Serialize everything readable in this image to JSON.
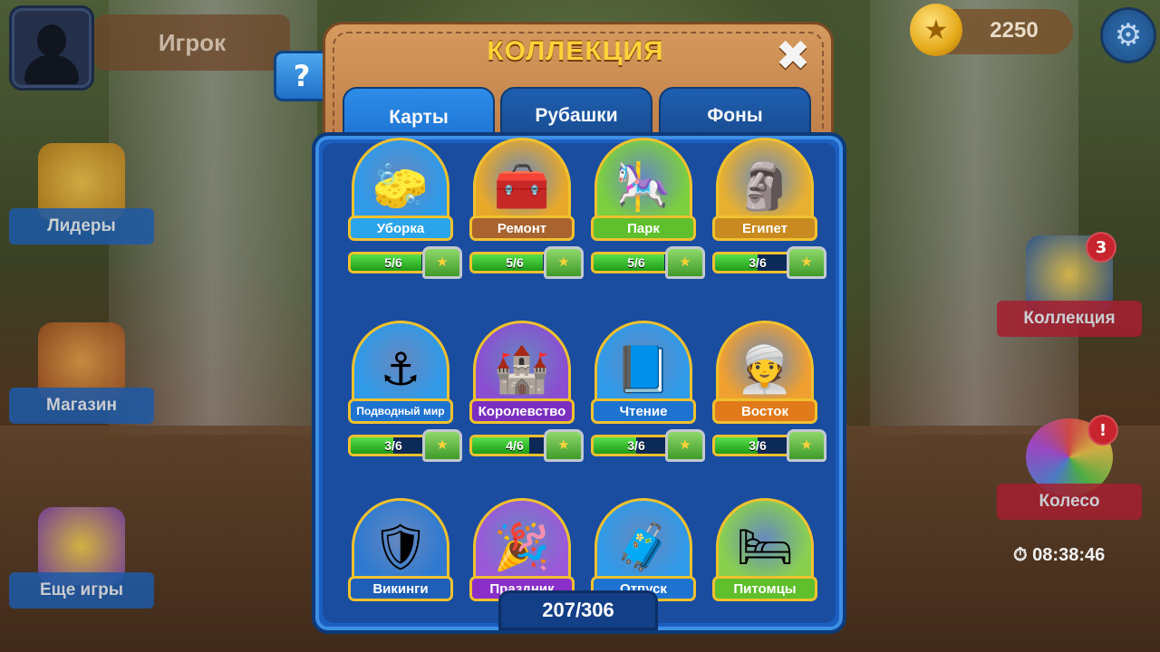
{
  "player": {
    "name": "Игрок"
  },
  "coins": {
    "value": "2250"
  },
  "left_menu": {
    "leaders": "Лидеры",
    "shop": "Магазин",
    "more_games": "Еще игры"
  },
  "right_menu": {
    "collection": "Коллекция",
    "collection_badge": "3",
    "wheel": "Колесо",
    "wheel_badge": "!",
    "timer": "08:38:46"
  },
  "panel": {
    "title": "КОЛЛЕКЦИЯ",
    "help": "?",
    "close": "✖",
    "tabs": [
      "Карты",
      "Рубашки",
      "Фоны"
    ],
    "active_tab": "Карты",
    "total": "207/306"
  },
  "cards": [
    {
      "name": "Уборка",
      "progress": "5/6",
      "fraction": 0.833,
      "icon": "bucket-icon",
      "glyph": "🧽",
      "color": "#2f9ae8",
      "label_color": "#2aa4ea"
    },
    {
      "name": "Ремонт",
      "progress": "5/6",
      "fraction": 0.833,
      "icon": "toolbox-icon",
      "glyph": "🧰",
      "color": "#e8a82a",
      "label_color": "#a8632e"
    },
    {
      "name": "Парк",
      "progress": "5/6",
      "fraction": 0.833,
      "icon": "carousel-icon",
      "glyph": "🎠",
      "color": "#7ccf3f",
      "label_color": "#5fbf2c"
    },
    {
      "name": "Египет",
      "progress": "3/6",
      "fraction": 0.5,
      "icon": "tablet-icon",
      "glyph": "🗿",
      "color": "#e8b030",
      "label_color": "#c98a1f"
    },
    {
      "name": "Подводный мир",
      "progress": "3/6",
      "fraction": 0.5,
      "icon": "anchor-icon",
      "glyph": "⚓",
      "color": "#2f9ae8",
      "label_color": "#1f73d0"
    },
    {
      "name": "Королевство",
      "progress": "4/6",
      "fraction": 0.667,
      "icon": "castle-icon",
      "glyph": "🏰",
      "color": "#8a4fd0",
      "label_color": "#7a2fc0"
    },
    {
      "name": "Чтение",
      "progress": "3/6",
      "fraction": 0.5,
      "icon": "book-icon",
      "glyph": "📘",
      "color": "#2f9ae8",
      "label_color": "#1f73d0"
    },
    {
      "name": "Восток",
      "progress": "3/6",
      "fraction": 0.5,
      "icon": "turban-icon",
      "glyph": "👳",
      "color": "#f0a030",
      "label_color": "#e07a1a"
    },
    {
      "name": "Викинги",
      "progress": "",
      "fraction": 0,
      "icon": "helmet-icon",
      "glyph": "🛡",
      "color": "#2f7ad0",
      "label_color": "#1f5fb8"
    },
    {
      "name": "Праздник",
      "progress": "",
      "fraction": 0,
      "icon": "party-hat-icon",
      "glyph": "🎉",
      "color": "#9a5ad8",
      "label_color": "#8a2fc8"
    },
    {
      "name": "Отпуск",
      "progress": "",
      "fraction": 0,
      "icon": "suitcase-icon",
      "glyph": "🧳",
      "color": "#2f9ae8",
      "label_color": "#1f73d0"
    },
    {
      "name": "Питомцы",
      "progress": "",
      "fraction": 0,
      "icon": "pet-bed-icon",
      "glyph": "🛏",
      "color": "#8ad04f",
      "label_color": "#5fbf2c"
    }
  ]
}
